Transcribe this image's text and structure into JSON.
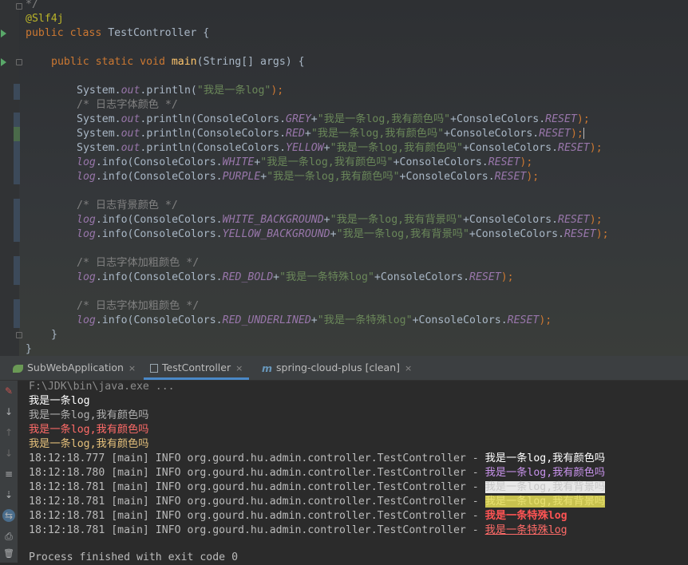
{
  "editor": {
    "lines": {
      "l0": "*/",
      "l1": "@Slf4j",
      "l2_kw": "public class ",
      "l2_name": "TestController {",
      "l4_kw": "public static void ",
      "l4_fn": "main",
      "l4_rest": "(String[] args) {",
      "l6_a": "System.",
      "l6_out": "out",
      "l6_b": ".println(",
      "l6_str": "\"我是一条log\"",
      "l6_c": ");",
      "l7": "/* 日志字体颜色 */",
      "l8_a": "System.",
      "l8_out": "out",
      "l8_b": ".println(ConsoleColors.",
      "l8_f": "GREY",
      "l8_c": "+",
      "l8_str": "\"我是一条log,我有颜色吗\"",
      "l8_d": "+ConsoleColors.",
      "l8_r": "RESET",
      "l8_e": ");",
      "l9_a": "System.",
      "l9_out": "out",
      "l9_b": ".println(ConsoleColors.",
      "l9_f": "RED",
      "l9_c": "+",
      "l9_str": "\"我是一条log,我有颜色吗\"",
      "l9_d": "+ConsoleColors.",
      "l9_r": "RESET",
      "l9_e": ");",
      "l10_a": "System.",
      "l10_out": "out",
      "l10_b": ".println(ConsoleColors.",
      "l10_f": "YELLOW",
      "l10_c": "+",
      "l10_str": "\"我是一条log,我有颜色吗\"",
      "l10_d": "+ConsoleColors.",
      "l10_r": "RESET",
      "l10_e": ");",
      "l11_log": "log",
      "l11_b": ".info(ConsoleColors.",
      "l11_f": "WHITE",
      "l11_c": "+",
      "l11_str": "\"我是一条log,我有颜色吗\"",
      "l11_d": "+ConsoleColors.",
      "l11_r": "RESET",
      "l11_e": ");",
      "l12_log": "log",
      "l12_b": ".info(ConsoleColors.",
      "l12_f": "PURPLE",
      "l12_c": "+",
      "l12_str": "\"我是一条log,我有颜色吗\"",
      "l12_d": "+ConsoleColors.",
      "l12_r": "RESET",
      "l12_e": ");",
      "l14": "/* 日志背景颜色 */",
      "l15_log": "log",
      "l15_b": ".info(ConsoleColors.",
      "l15_f": "WHITE_BACKGROUND",
      "l15_c": "+",
      "l15_str": "\"我是一条log,我有背景吗\"",
      "l15_d": "+ConsoleColors.",
      "l15_r": "RESET",
      "l15_e": ");",
      "l16_log": "log",
      "l16_b": ".info(ConsoleColors.",
      "l16_f": "YELLOW_BACKGROUND",
      "l16_c": "+",
      "l16_str": "\"我是一条log,我有背景吗\"",
      "l16_d": "+ConsoleColors.",
      "l16_r": "RESET",
      "l16_e": ");",
      "l18": "/* 日志字体加粗颜色 */",
      "l19_log": "log",
      "l19_b": ".info(ConsoleColors.",
      "l19_f": "RED_BOLD",
      "l19_c": "+",
      "l19_str": "\"我是一条特殊log\"",
      "l19_d": "+ConsoleColors.",
      "l19_r": "RESET",
      "l19_e": ");",
      "l21": "/* 日志字体加粗颜色 */",
      "l22_log": "log",
      "l22_b": ".info(ConsoleColors.",
      "l22_f": "RED_UNDERLINED",
      "l22_c": "+",
      "l22_str": "\"我是一条特殊log\"",
      "l22_d": "+ConsoleColors.",
      "l22_r": "RESET",
      "l22_e": ");",
      "l23": "}",
      "l24": "}"
    }
  },
  "tabs": [
    {
      "label": "SubWebApplication"
    },
    {
      "label": "TestController"
    },
    {
      "label": "spring-cloud-plus [clean]"
    }
  ],
  "tab_close": "×",
  "tools": {
    "stop": "✎",
    "sort": "↓",
    "up": "↑",
    "down": "↓",
    "wrap": "≡",
    "scroll": "⇣",
    "pin": "⇆",
    "print": "⎙",
    "trash": "🗑"
  },
  "console": {
    "cmd": "F:\\JDK\\bin\\java.exe ...",
    "out1": "我是一条log",
    "out2": "我是一条log,我有颜色吗",
    "out3": "我是一条log,我有颜色吗",
    "out4": "我是一条log,我有颜色吗",
    "log_rows": [
      {
        "prefix": "18:12:18.777 [main] INFO org.gourd.hu.admin.controller.TestController - ",
        "msg": "我是一条log,我有颜色吗"
      },
      {
        "prefix": "18:12:18.780 [main] INFO org.gourd.hu.admin.controller.TestController - ",
        "msg": "我是一条log,我有颜色吗"
      },
      {
        "prefix": "18:12:18.781 [main] INFO org.gourd.hu.admin.controller.TestController - ",
        "msg": "我是一条log,我有背景吗"
      },
      {
        "prefix": "18:12:18.781 [main] INFO org.gourd.hu.admin.controller.TestController - ",
        "msg": "我是一条log,我有背景吗"
      },
      {
        "prefix": "18:12:18.781 [main] INFO org.gourd.hu.admin.controller.TestController - ",
        "msg": "我是一条特殊log"
      },
      {
        "prefix": "18:12:18.781 [main] INFO org.gourd.hu.admin.controller.TestController - ",
        "msg": "我是一条特殊log"
      }
    ],
    "exit": "Process finished with exit code 0"
  },
  "colors": {
    "accent_tab": "#4a88c7",
    "keyword": "#cc7832",
    "string": "#6a8759",
    "field": "#9876aa",
    "annotation": "#bbb529",
    "run_icon": "#59a869"
  }
}
